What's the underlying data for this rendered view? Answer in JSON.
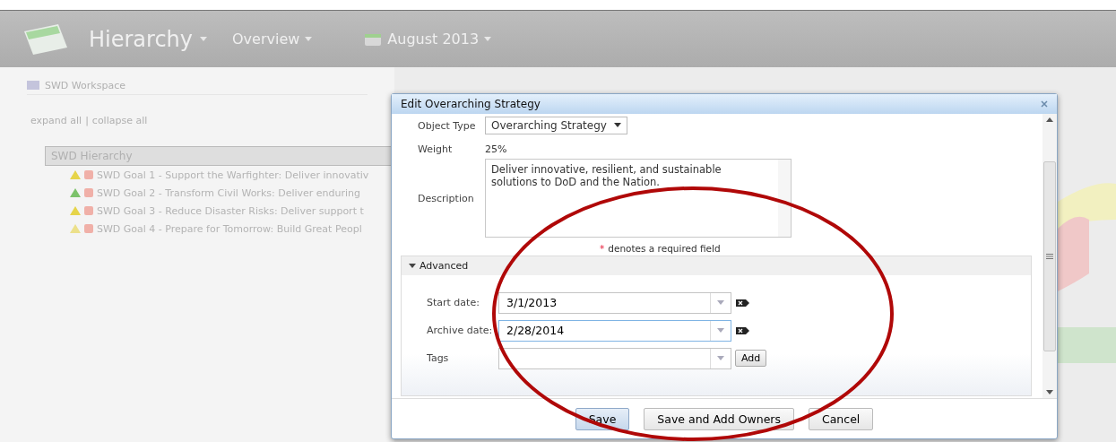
{
  "header": {
    "title": "Hierarchy",
    "nav": [
      {
        "label": "Overview",
        "kind": "menu"
      },
      {
        "label": "August 2013",
        "kind": "date"
      }
    ]
  },
  "sidebar": {
    "workspace": "SWD Workspace",
    "links": [
      "expand all",
      "|",
      "collapse all"
    ],
    "tree": {
      "label": "SWD Hierarchy",
      "selected": true,
      "children": [
        {
          "label": "SWD Goal 1 - Support the Warfighter: Deliver innovativ",
          "color": "#e6d44a",
          "selected": false
        },
        {
          "label": "SWD Goal 2 - Transform Civil Works: Deliver enduring",
          "color": "#7cc26a",
          "selected": false
        },
        {
          "label": "SWD Goal 3 - Reduce Disaster Risks: Deliver support t",
          "color": "#e6d44a",
          "selected": false
        },
        {
          "label": "SWD Goal 4 - Prepare for Tomorrow: Build Great Peopl",
          "color": "#ece08a",
          "selected": false
        }
      ]
    }
  },
  "dialog": {
    "title": "Edit Overarching Strategy",
    "fields": [
      {
        "kind": "select",
        "label": "Object Type",
        "value": "Overarching Strategy"
      },
      {
        "kind": "text",
        "label": "Weight",
        "value": "25%"
      },
      {
        "kind": "textarea",
        "label": "Description",
        "value": "Deliver innovative, resilient, and sustainable solutions to DoD and the Nation."
      }
    ],
    "required_mark": "*",
    "required_note": "denotes a required field",
    "advanced": {
      "title": "Advanced",
      "expanded": true,
      "fields": [
        {
          "kind": "date",
          "label": "Start date:",
          "value": "3/1/2013",
          "focused": false
        },
        {
          "kind": "date",
          "label": "Archive date:",
          "value": "2/28/2014",
          "focused": true
        },
        {
          "kind": "tags",
          "label": "Tags",
          "button": "Add",
          "focused": false
        }
      ]
    },
    "buttons": [
      {
        "label": "Save",
        "default": true
      },
      {
        "label": "Save and Add Owners",
        "default": false
      },
      {
        "label": "Cancel",
        "default": false
      }
    ]
  }
}
